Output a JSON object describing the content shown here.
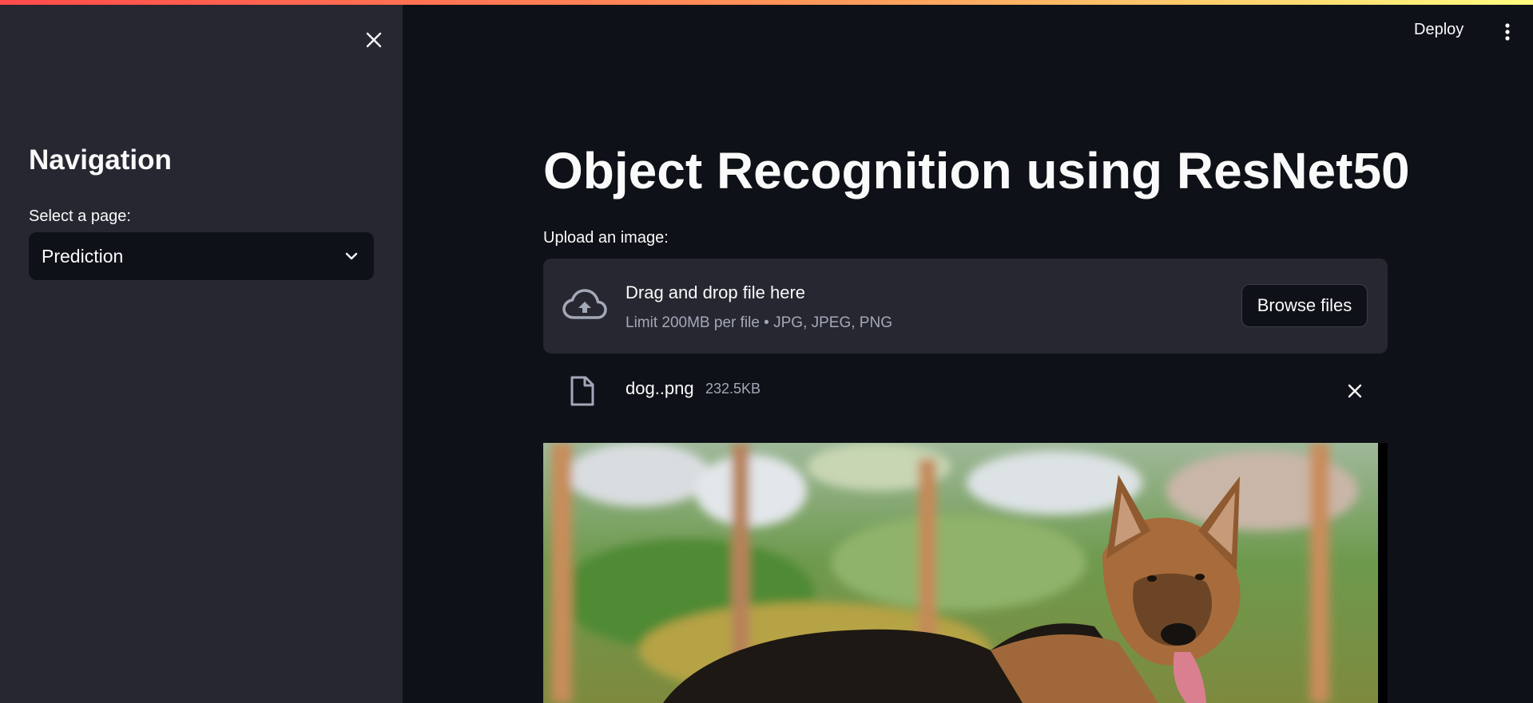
{
  "header": {
    "deploy_label": "Deploy",
    "menu_icon": "more-vertical-icon",
    "accent_gradient": [
      "#ff4b4b",
      "#fffd80"
    ]
  },
  "sidebar": {
    "title": "Navigation",
    "select_label": "Select a page:",
    "selected_page": "Prediction",
    "close_icon": "close-icon"
  },
  "main": {
    "title": "Object Recognition using ResNet50",
    "upload_label": "Upload an image:",
    "dropzone": {
      "title": "Drag and drop file here",
      "limit_text": "Limit 200MB per file • JPG, JPEG, PNG",
      "browse_label": "Browse files",
      "icon": "cloud-upload-icon"
    },
    "uploaded_file": {
      "name": "dog..png",
      "size": "232.5KB",
      "icon": "file-icon",
      "remove_icon": "close-icon"
    },
    "preview_image": {
      "subject": "German Shepherd dog standing outdoors"
    }
  },
  "colors": {
    "background": "#0e1117",
    "sidebar": "#262730",
    "text": "#fafafa",
    "muted_text": "#a3a8b8"
  }
}
